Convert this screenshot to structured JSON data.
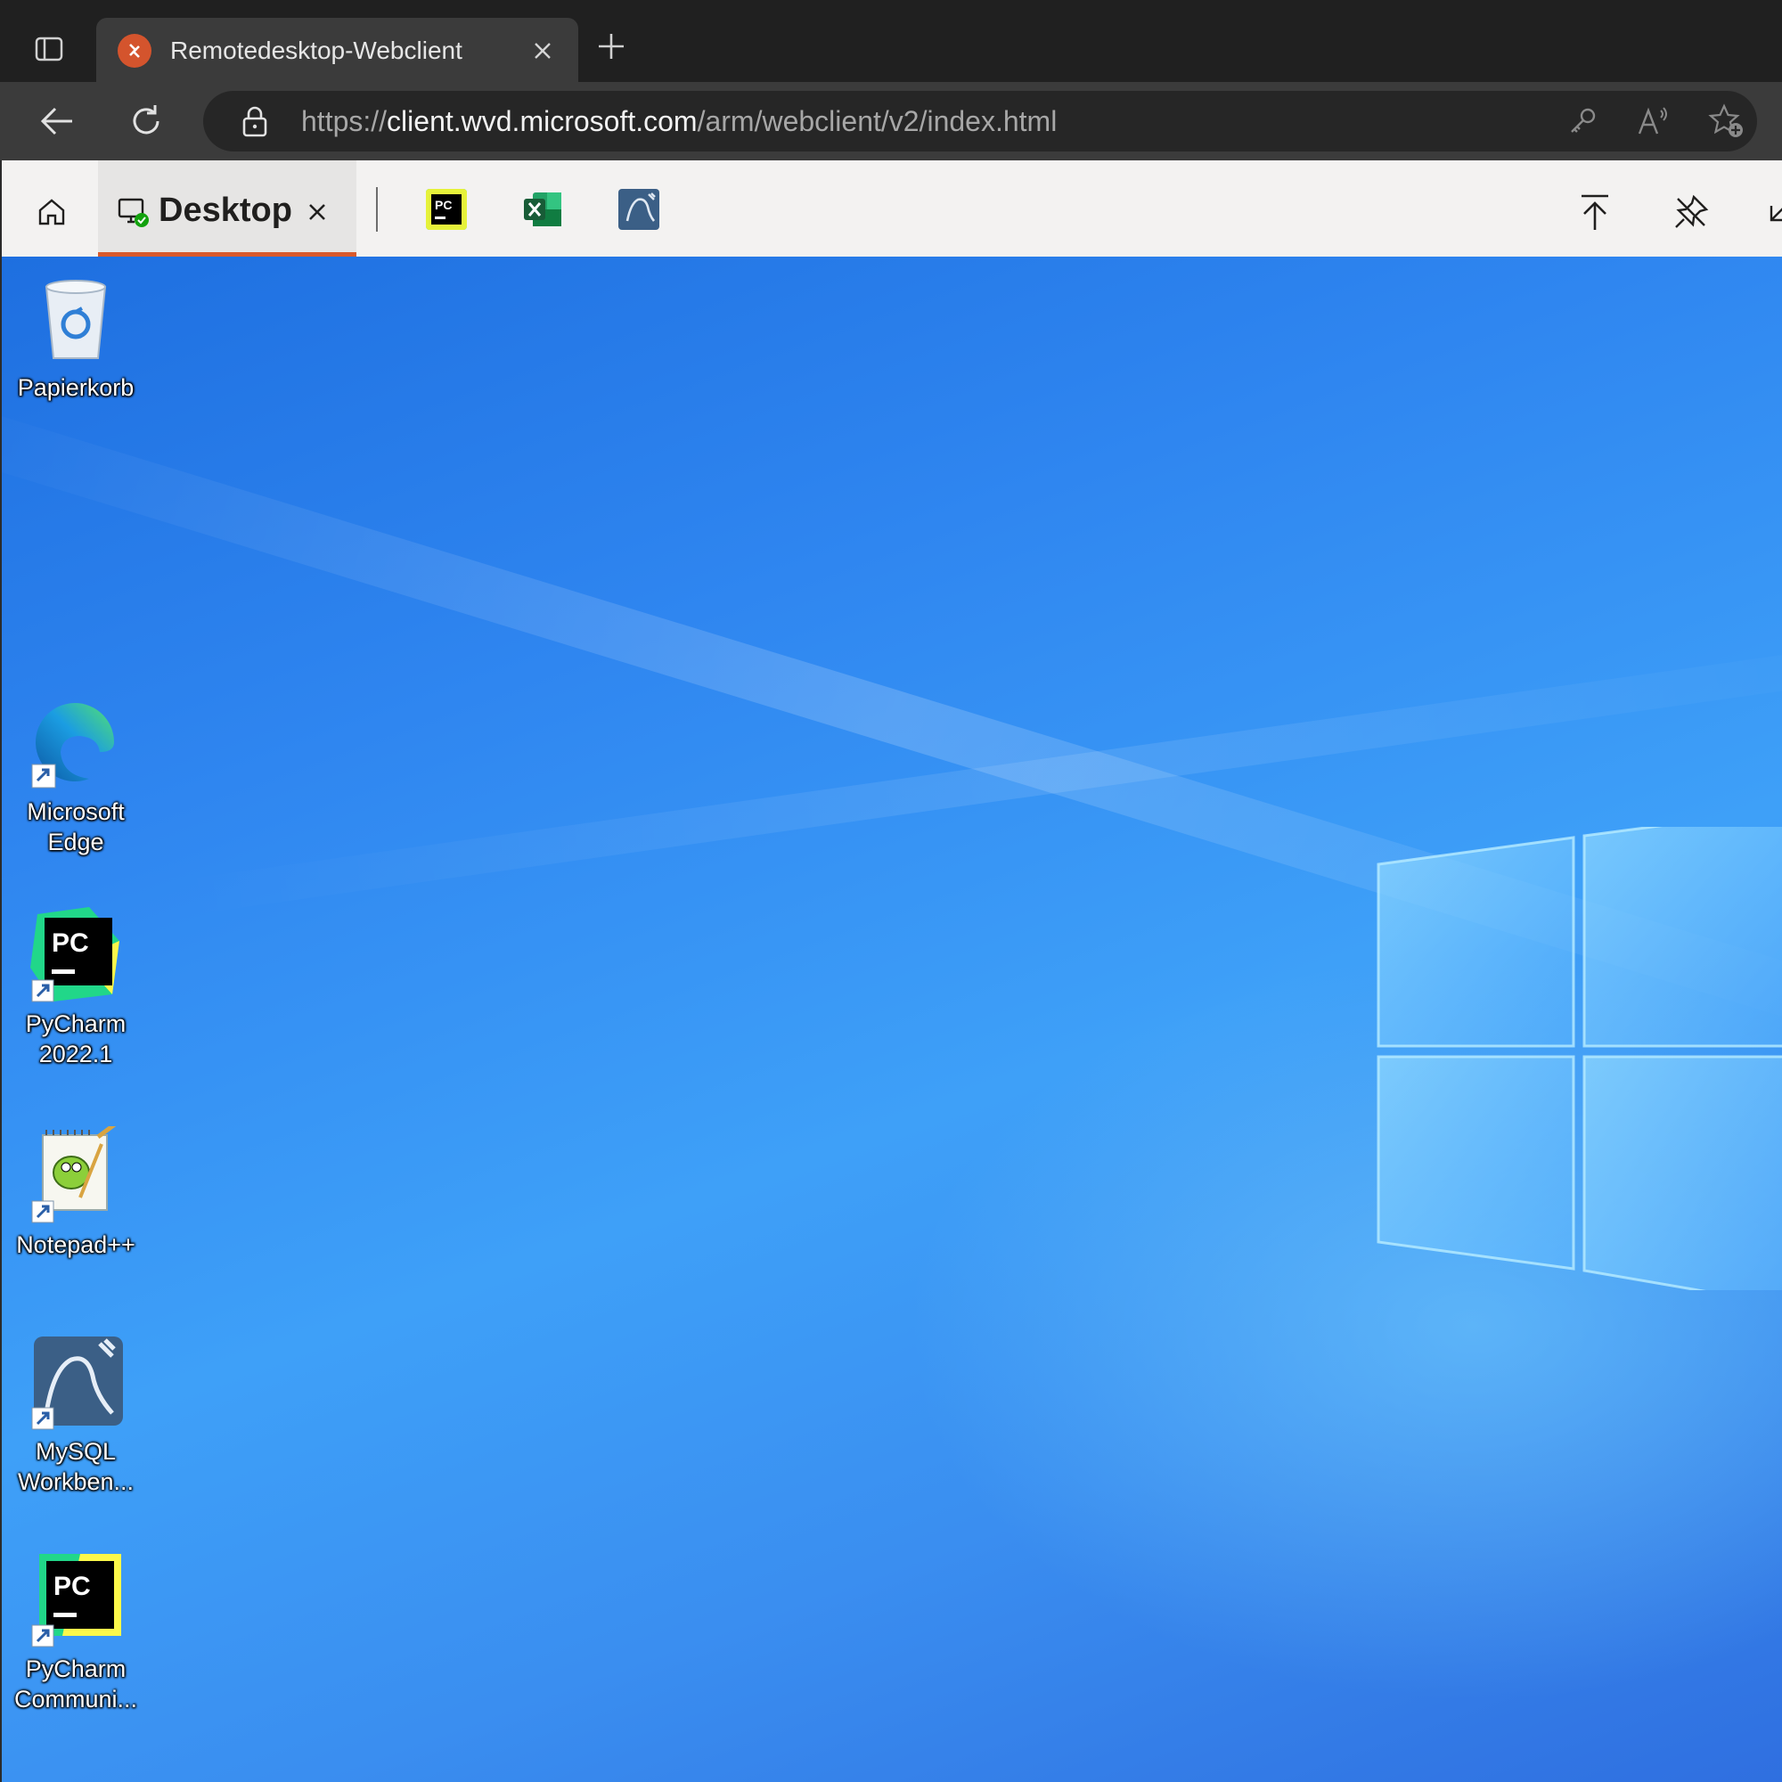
{
  "browser": {
    "tab_title": "Remotedesktop-Webclient",
    "url_scheme": "https://",
    "url_host": "client.wvd.microsoft.com",
    "url_path": "/arm/webclient/v2/index.html"
  },
  "rd_client": {
    "active_tab_label": "Desktop",
    "pinned_apps": [
      "PyCharm",
      "Excel",
      "MySQL Workbench"
    ]
  },
  "desktop": {
    "icons": [
      {
        "label": "Papierkorb",
        "icon": "recycle-bin-icon"
      },
      {
        "label": "Microsoft Edge",
        "icon": "edge-icon"
      },
      {
        "label": "PyCharm 2022.1",
        "icon": "pycharm-icon"
      },
      {
        "label": "Notepad++",
        "icon": "notepadpp-icon"
      },
      {
        "label": "MySQL Workben...",
        "icon": "mysql-workbench-icon"
      },
      {
        "label": "PyCharm Communi...",
        "icon": "pycharm-community-icon"
      }
    ]
  },
  "colors": {
    "accent": "#d8592c",
    "desktop_blue": "#3a96f5"
  }
}
